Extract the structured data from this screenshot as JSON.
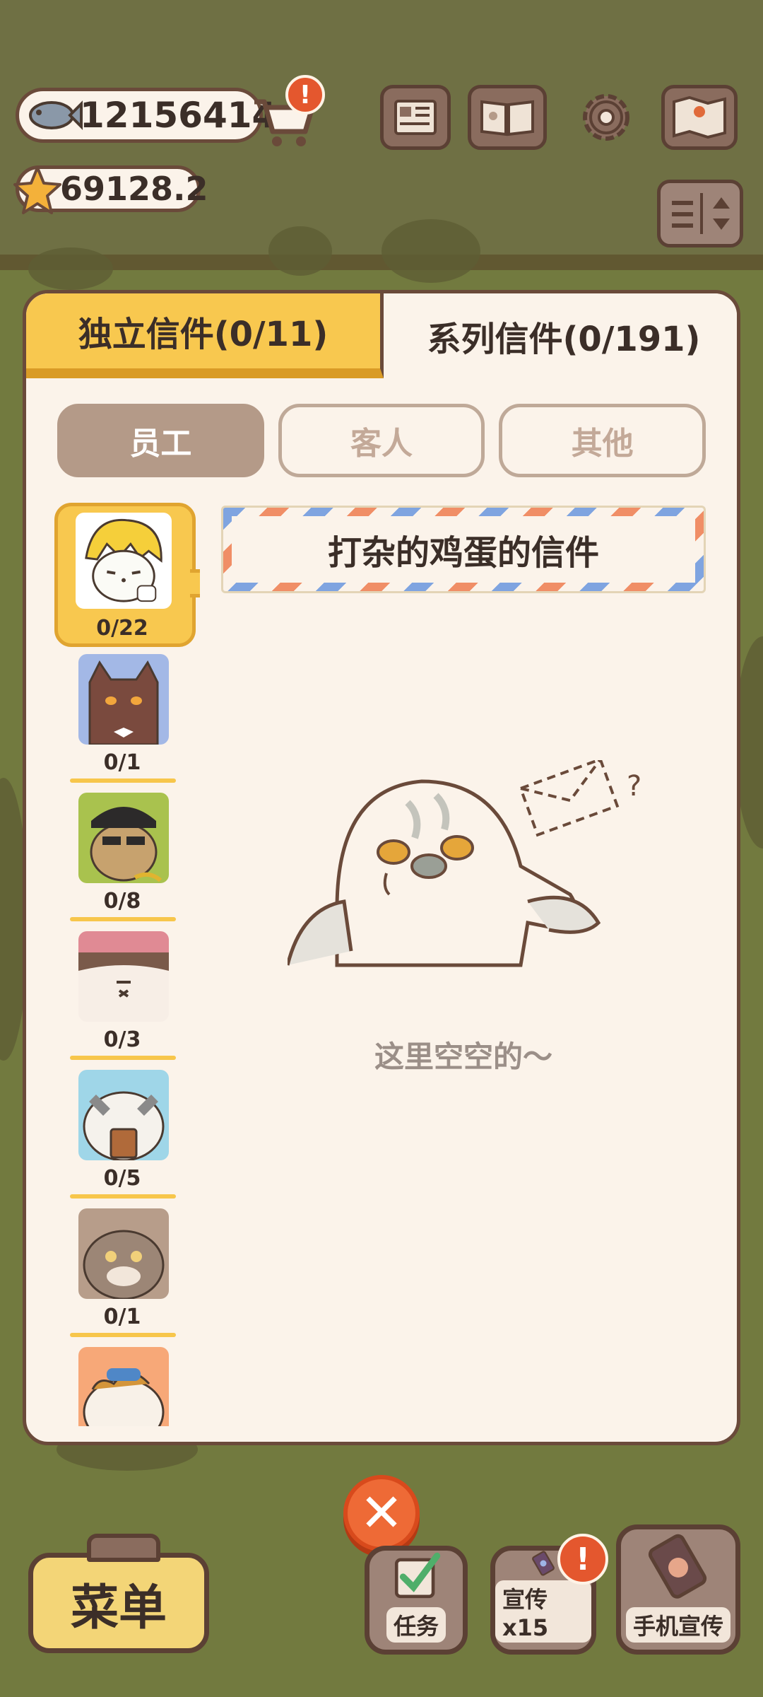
{
  "hud": {
    "fish_count": "12156414",
    "star_count": "69128.2",
    "cart_badge": "!"
  },
  "top_buttons": [
    {
      "name": "newspaper-icon"
    },
    {
      "name": "book-icon"
    },
    {
      "name": "gear-icon"
    },
    {
      "name": "map-icon"
    }
  ],
  "dialog": {
    "tabs": [
      {
        "label": "独立信件(0/11)",
        "active": true
      },
      {
        "label": "系列信件(0/191)",
        "active": false
      }
    ],
    "chips": [
      {
        "label": "员工",
        "active": true
      },
      {
        "label": "客人",
        "active": false
      },
      {
        "label": "其他",
        "active": false
      }
    ],
    "portraits": [
      {
        "count": "0/22",
        "selected": true,
        "bg": "#ffffff"
      },
      {
        "count": "0/1",
        "selected": false,
        "bg": "#a3b8e6"
      },
      {
        "count": "0/8",
        "selected": false,
        "bg": "#a9c24e"
      },
      {
        "count": "0/3",
        "selected": false,
        "bg": "#f7eee6"
      },
      {
        "count": "0/5",
        "selected": false,
        "bg": "#9fd6e8"
      },
      {
        "count": "0/1",
        "selected": false,
        "bg": "#b79d8a"
      },
      {
        "count": "",
        "selected": false,
        "bg": "#f7a878"
      }
    ],
    "letter_title": "打杂的鸡蛋的信件",
    "empty_text": "这里空空的～"
  },
  "bottom": {
    "menu_label": "菜单",
    "buttons": [
      {
        "label": "任务",
        "icon": "checkbox-icon"
      },
      {
        "label": "宣传x15",
        "icon": "phone-icon",
        "badge": "!"
      },
      {
        "label": "手机宣传",
        "icon": "phone-paw-icon"
      }
    ]
  },
  "colors": {
    "accent_yellow": "#f8c84f",
    "panel": "#fbf3ea",
    "border": "#6a4a3a",
    "close_orange": "#ee6a36"
  }
}
